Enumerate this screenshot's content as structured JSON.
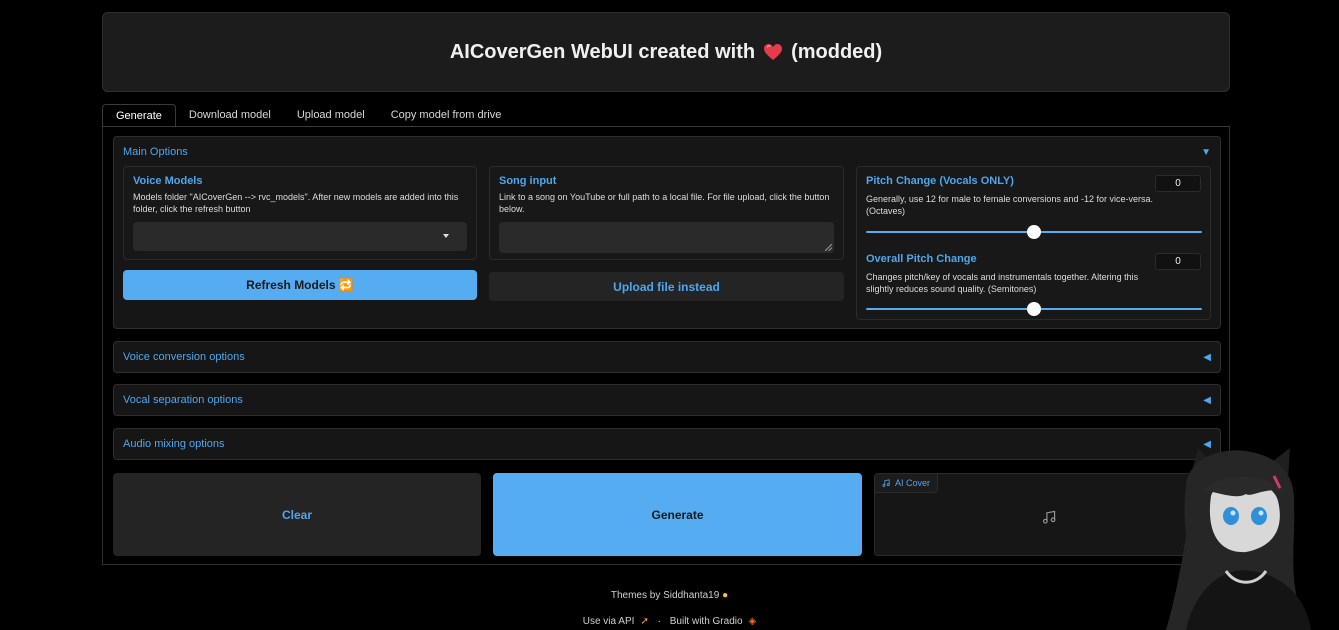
{
  "header": {
    "title": "AICoverGen WebUI created with",
    "suffix": "(modded)"
  },
  "tabs": [
    {
      "label": "Generate",
      "active": true
    },
    {
      "label": "Download model"
    },
    {
      "label": "Upload model"
    },
    {
      "label": "Copy model from drive"
    }
  ],
  "main_options": {
    "title": "Main Options",
    "voice_models": {
      "label": "Voice Models",
      "info": "Models folder \"AICoverGen --> rvc_models\". After new models are added into this folder, click the refresh button",
      "value": ""
    },
    "refresh_button": "Refresh Models 🔁",
    "song_input": {
      "label": "Song input",
      "info": "Link to a song on YouTube or full path to a local file. For file upload, click the button below.",
      "value": ""
    },
    "upload_button": "Upload file instead",
    "pitch_change": {
      "label": "Pitch Change (Vocals ONLY)",
      "info": "Generally, use 12 for male to female conversions and -12 for vice-versa. (Octaves)",
      "value": "0",
      "fraction": 0.5
    },
    "overall_pitch": {
      "label": "Overall Pitch Change",
      "info": "Changes pitch/key of vocals and instrumentals together. Altering this slightly reduces sound quality. (Semitones)",
      "value": "0",
      "fraction": 0.5
    }
  },
  "accordions": {
    "voice_conversion": "Voice conversion options",
    "vocal_separation": "Vocal separation options",
    "audio_mixing": "Audio mixing options"
  },
  "actions": {
    "clear": "Clear",
    "generate": "Generate"
  },
  "audio_output": {
    "label": "AI Cover"
  },
  "footer": {
    "themes": "Themes by Siddhanta19",
    "api": "Use via API",
    "separator": "·",
    "built": "Built with Gradio"
  },
  "colors": {
    "accent": "#4ea6ee",
    "button_primary": "#55acf0",
    "background": "#000000",
    "panel": "#161616"
  }
}
